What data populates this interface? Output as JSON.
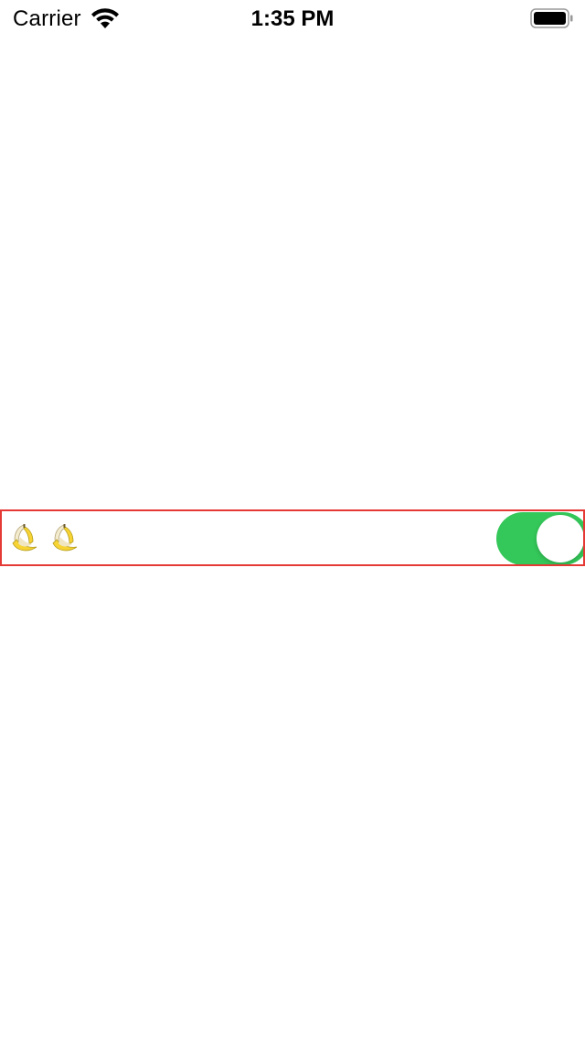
{
  "status_bar": {
    "carrier": "Carrier",
    "time": "1:35 PM",
    "wifi_icon": "wifi-icon",
    "battery_icon": "battery-icon"
  },
  "row": {
    "label": "🍌🍌",
    "label_icons": [
      "banana-icon",
      "banana-icon"
    ],
    "switch_on": true,
    "switch_color": "#34c759",
    "highlight_color": "#e53935"
  }
}
